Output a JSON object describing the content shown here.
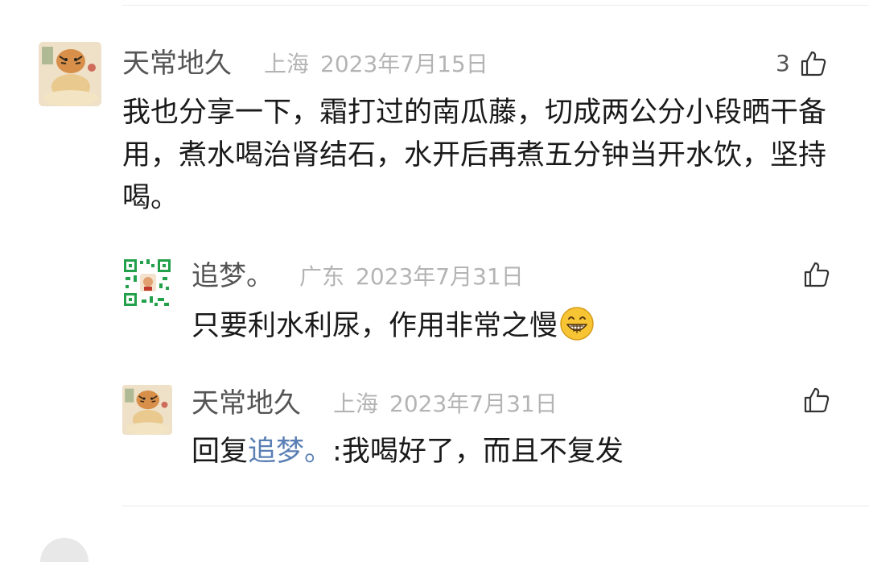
{
  "comment": {
    "author": "天常地久",
    "location": "上海",
    "date": "2023年7月15日",
    "likes": "3",
    "text": "我也分享一下，霜打过的南瓜藤，切成两公分小段晒干备用，煮水喝治肾结石，水开后再煮五分钟当开水饮，坚持喝。"
  },
  "replies": [
    {
      "author": "追梦。",
      "location": "广东",
      "date": "2023年7月31日",
      "text": "只要利水利尿，作用非常之慢",
      "emoji": "grinning-face-emoji"
    },
    {
      "author": "天常地久",
      "location": "上海",
      "date": "2023年7月31日",
      "reply_prefix": "回复",
      "mention": "追梦。",
      "text": ":我喝好了，而且不复发"
    }
  ],
  "icons": {
    "like": "thumbs-up-icon",
    "avatar_tiger": "tiger-avatar",
    "avatar_qr": "qr-avatar"
  },
  "colors": {
    "name": "#555555",
    "meta": "#b4b4b4",
    "text": "#1a1a1a",
    "mention": "#5a7fb4",
    "divider": "#ebebeb"
  }
}
